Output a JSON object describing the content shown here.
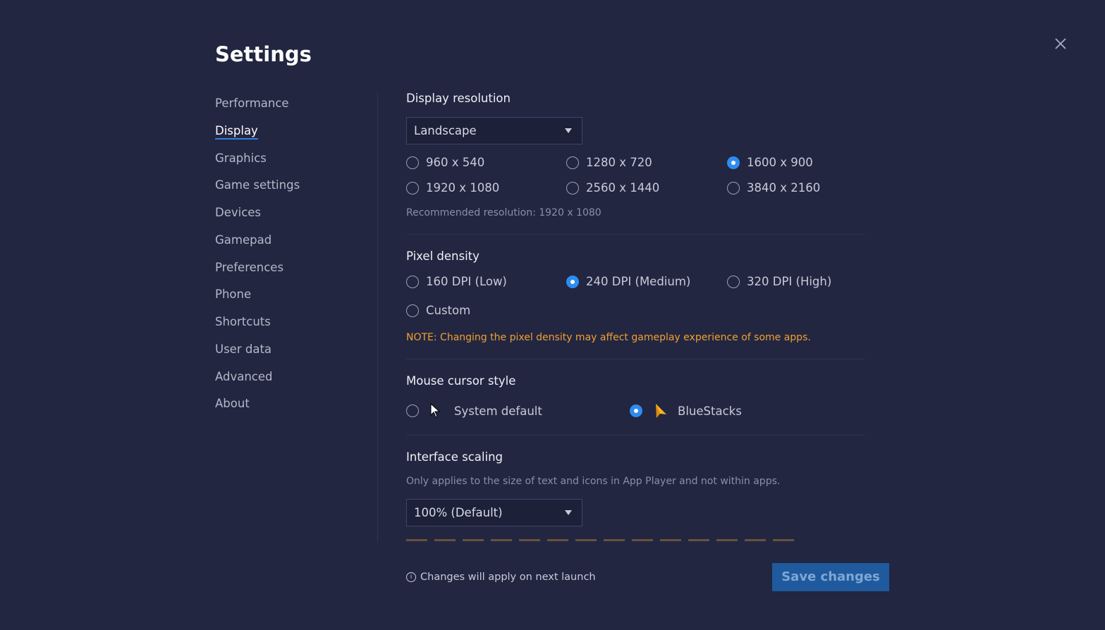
{
  "title": "Settings",
  "sidebar": {
    "items": [
      {
        "label": "Performance"
      },
      {
        "label": "Display",
        "active": true
      },
      {
        "label": "Graphics"
      },
      {
        "label": "Game settings"
      },
      {
        "label": "Devices"
      },
      {
        "label": "Gamepad"
      },
      {
        "label": "Preferences"
      },
      {
        "label": "Phone"
      },
      {
        "label": "Shortcuts"
      },
      {
        "label": "User data"
      },
      {
        "label": "Advanced"
      },
      {
        "label": "About"
      }
    ]
  },
  "display_resolution": {
    "heading": "Display resolution",
    "orientation": "Landscape",
    "options": [
      "960 x 540",
      "1280 x 720",
      "1600 x 900",
      "1920 x 1080",
      "2560 x 1440",
      "3840 x 2160"
    ],
    "selected": "1600 x 900",
    "recommended": "Recommended resolution: 1920 x 1080"
  },
  "pixel_density": {
    "heading": "Pixel density",
    "options": [
      "160 DPI (Low)",
      "240 DPI (Medium)",
      "320 DPI (High)",
      "Custom"
    ],
    "selected": "240 DPI (Medium)",
    "note": "NOTE: Changing the pixel density may affect gameplay experience of some apps."
  },
  "mouse_cursor": {
    "heading": "Mouse cursor style",
    "options": [
      "System default",
      "BlueStacks"
    ],
    "selected": "BlueStacks"
  },
  "interface_scaling": {
    "heading": "Interface scaling",
    "description": "Only applies to the size of text and icons in App Player and not within apps.",
    "value": "100% (Default)"
  },
  "footer": {
    "info": "Changes will apply on next launch",
    "save_label": "Save changes"
  },
  "colors": {
    "accent": "#2e8cf0",
    "background": "#222641",
    "note": "#f0a030",
    "save_button": "#1f5a9e"
  }
}
